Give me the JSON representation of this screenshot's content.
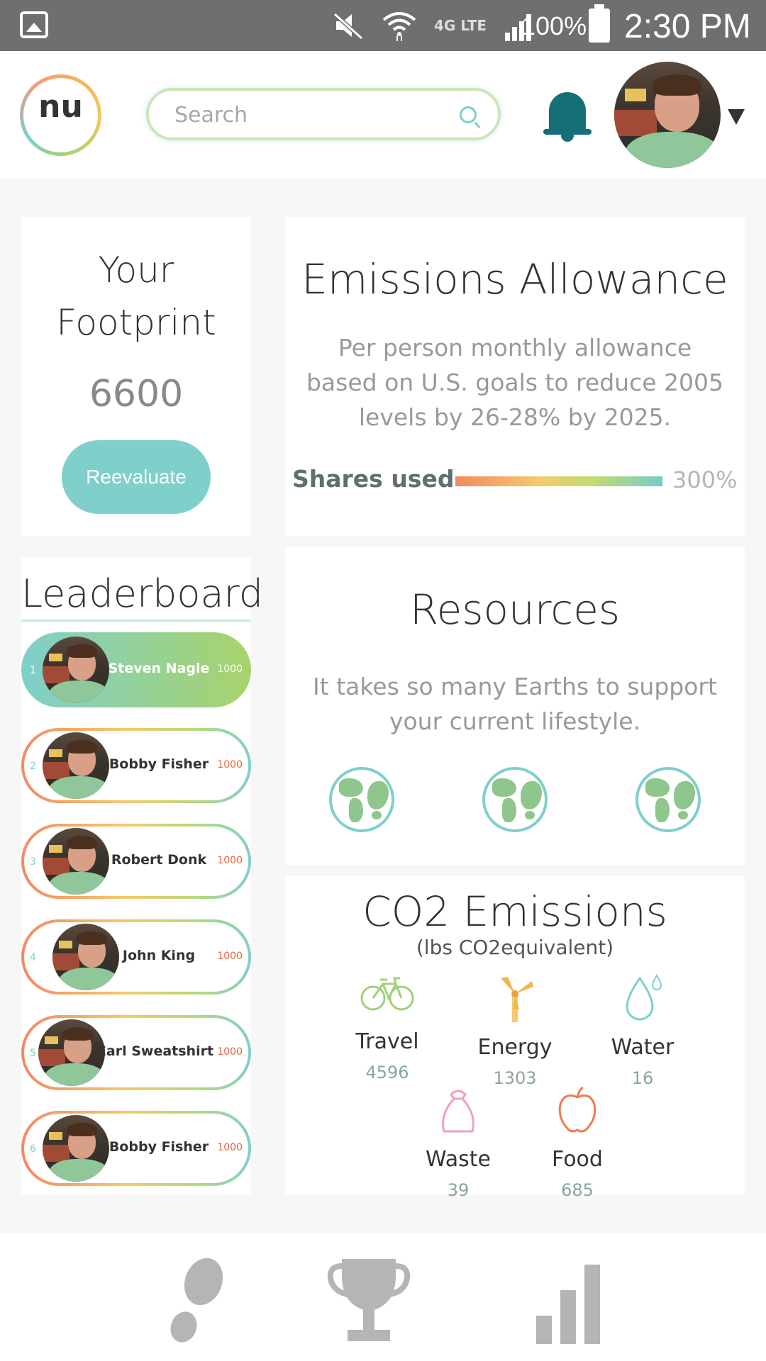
{
  "status_bar": {
    "battery": "100%",
    "time": "2:30 PM",
    "network_label": "4G LTE",
    "icons": [
      "gallery-icon",
      "mute-icon",
      "wifi-icon",
      "lte-icon",
      "signal-icon",
      "battery-icon"
    ]
  },
  "header": {
    "logo_text": "nu",
    "search_placeholder": "Search",
    "icons": [
      "search-icon",
      "bell-icon",
      "chevron-down-icon"
    ]
  },
  "footprint": {
    "title": "Your Footprint",
    "value": "6600",
    "button_label": "Reevaluate"
  },
  "emissions": {
    "title": "Emissions Allowance",
    "description": "Per person monthly allowance based on U.S. goals to reduce 2005 levels by 26-28% by 2025.",
    "shares_label": "Shares used",
    "shares_value": "300%"
  },
  "leaderboard": {
    "title": "Leaderboard",
    "rows": [
      {
        "rank": "1",
        "name": "Steven Nagle",
        "score": "1000"
      },
      {
        "rank": "2",
        "name": "Bobby Fisher",
        "score": "1000"
      },
      {
        "rank": "3",
        "name": "Robert Donk",
        "score": "1000"
      },
      {
        "rank": "4",
        "name": "John King",
        "score": "1000"
      },
      {
        "rank": "5",
        "name": "Earl Sweatshirt",
        "score": "1000"
      },
      {
        "rank": "6",
        "name": "Bobby Fisher",
        "score": "1000"
      }
    ]
  },
  "resources": {
    "title": "Resources",
    "description": "It takes so many Earths to support your current lifestyle.",
    "earths_count": 3
  },
  "co2": {
    "title": "CO2 Emissions",
    "subtitle": "(lbs CO2equivalent)",
    "categories": [
      {
        "label": "Travel",
        "value": "4596",
        "icon": "bicycle-icon"
      },
      {
        "label": "Energy",
        "value": "1303",
        "icon": "wind-turbine-icon"
      },
      {
        "label": "Water",
        "value": "16",
        "icon": "water-drop-icon"
      },
      {
        "label": "Waste",
        "value": "39",
        "icon": "trash-bag-icon"
      },
      {
        "label": "Food",
        "value": "685",
        "icon": "apple-icon"
      }
    ]
  },
  "bottom_nav": {
    "items": [
      "footprint-icon",
      "trophy-icon",
      "bar-chart-icon"
    ]
  },
  "colors": {
    "accent_teal": "#7fcfcb",
    "bell": "#146f78",
    "status_bar": "#6f6f6f",
    "score_orange": "#e8633a"
  }
}
